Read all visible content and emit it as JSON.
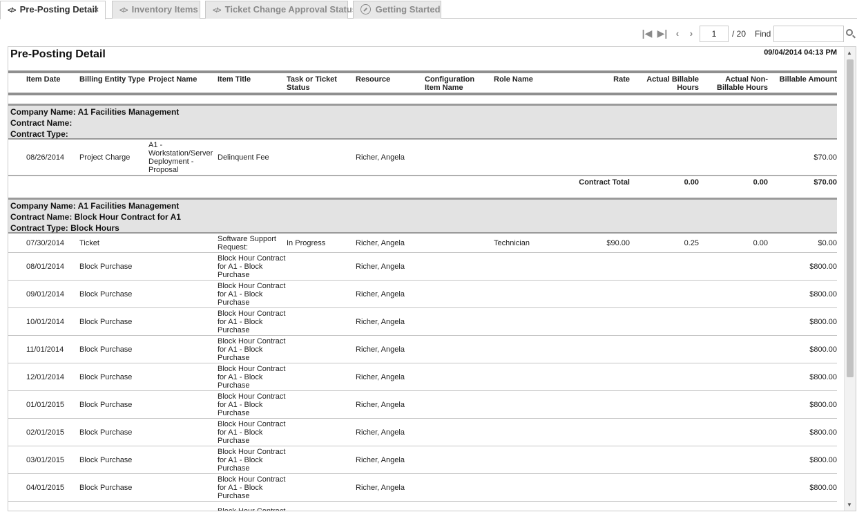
{
  "tabs": [
    {
      "label": "Pre-Posting Detail",
      "icon": "code-icon",
      "close": "×"
    },
    {
      "label": "Inventory Items",
      "icon": "code-icon"
    },
    {
      "label": "Ticket Change Approval Status",
      "icon": "code-icon"
    },
    {
      "label": "Getting Started",
      "icon": "arrow-circle-icon"
    }
  ],
  "toolbar": {
    "page": "1",
    "page_total": "/ 20",
    "find_label": "Find",
    "find_value": ""
  },
  "report": {
    "title": "Pre-Posting Detail",
    "date": "09/04/2014 04:13 PM",
    "columns": [
      "Item Date",
      "Billing Entity Type",
      "Project Name",
      "Item Title",
      "Task or Ticket Status",
      "Resource",
      "Configuration Item Name",
      "Role Name",
      "Rate",
      "Actual Billable Hours",
      "Actual Non-Billable Hours",
      "Billable Amount"
    ],
    "groups": [
      {
        "company": "Company Name: A1 Facilities Management",
        "contract": "Contract Name:",
        "contract_type": "Contract Type:",
        "rows": [
          {
            "date": "08/26/2014",
            "type": "Project Charge",
            "project": "A1 - Workstation/Server Deployment - Proposal",
            "title": "Delinquent Fee",
            "status": "",
            "resource": "Richer, Angela",
            "ci": "",
            "role": "",
            "rate": "",
            "billable": "",
            "nonbillable": "",
            "amount": "$70.00"
          }
        ],
        "total": {
          "label": "Contract Total",
          "billable": "0.00",
          "nonbillable": "0.00",
          "amount": "$70.00"
        }
      },
      {
        "company": "Company Name: A1 Facilities Management",
        "contract": "Contract Name: Block Hour Contract for A1",
        "contract_type": "Contract Type: Block Hours",
        "rows": [
          {
            "date": "07/30/2014",
            "type": "Ticket",
            "project": "",
            "title": "Software Support Request:",
            "status": "In Progress",
            "resource": "Richer, Angela",
            "ci": "",
            "role": "Technician",
            "rate": "$90.00",
            "billable": "0.25",
            "nonbillable": "0.00",
            "amount": "$0.00"
          },
          {
            "date": "08/01/2014",
            "type": "Block Purchase",
            "project": "",
            "title": "Block Hour Contract for A1 - Block Purchase",
            "status": "",
            "resource": "Richer, Angela",
            "ci": "",
            "role": "",
            "rate": "",
            "billable": "",
            "nonbillable": "",
            "amount": "$800.00"
          },
          {
            "date": "09/01/2014",
            "type": "Block Purchase",
            "project": "",
            "title": "Block Hour Contract for A1 - Block Purchase",
            "status": "",
            "resource": "Richer, Angela",
            "ci": "",
            "role": "",
            "rate": "",
            "billable": "",
            "nonbillable": "",
            "amount": "$800.00"
          },
          {
            "date": "10/01/2014",
            "type": "Block Purchase",
            "project": "",
            "title": "Block Hour Contract for A1 - Block Purchase",
            "status": "",
            "resource": "Richer, Angela",
            "ci": "",
            "role": "",
            "rate": "",
            "billable": "",
            "nonbillable": "",
            "amount": "$800.00"
          },
          {
            "date": "11/01/2014",
            "type": "Block Purchase",
            "project": "",
            "title": "Block Hour Contract for A1 - Block Purchase",
            "status": "",
            "resource": "Richer, Angela",
            "ci": "",
            "role": "",
            "rate": "",
            "billable": "",
            "nonbillable": "",
            "amount": "$800.00"
          },
          {
            "date": "12/01/2014",
            "type": "Block Purchase",
            "project": "",
            "title": "Block Hour Contract for A1 - Block Purchase",
            "status": "",
            "resource": "Richer, Angela",
            "ci": "",
            "role": "",
            "rate": "",
            "billable": "",
            "nonbillable": "",
            "amount": "$800.00"
          },
          {
            "date": "01/01/2015",
            "type": "Block Purchase",
            "project": "",
            "title": "Block Hour Contract for A1 - Block Purchase",
            "status": "",
            "resource": "Richer, Angela",
            "ci": "",
            "role": "",
            "rate": "",
            "billable": "",
            "nonbillable": "",
            "amount": "$800.00"
          },
          {
            "date": "02/01/2015",
            "type": "Block Purchase",
            "project": "",
            "title": "Block Hour Contract for A1 - Block Purchase",
            "status": "",
            "resource": "Richer, Angela",
            "ci": "",
            "role": "",
            "rate": "",
            "billable": "",
            "nonbillable": "",
            "amount": "$800.00"
          },
          {
            "date": "03/01/2015",
            "type": "Block Purchase",
            "project": "",
            "title": "Block Hour Contract for A1 - Block Purchase",
            "status": "",
            "resource": "Richer, Angela",
            "ci": "",
            "role": "",
            "rate": "",
            "billable": "",
            "nonbillable": "",
            "amount": "$800.00"
          },
          {
            "date": "04/01/2015",
            "type": "Block Purchase",
            "project": "",
            "title": "Block Hour Contract for A1 - Block Purchase",
            "status": "",
            "resource": "Richer, Angela",
            "ci": "",
            "role": "",
            "rate": "",
            "billable": "",
            "nonbillable": "",
            "amount": "$800.00"
          },
          {
            "date": "",
            "type": "",
            "project": "",
            "title": "Block Hour Contract",
            "status": "",
            "resource": "",
            "ci": "",
            "role": "",
            "rate": "",
            "billable": "",
            "nonbillable": "",
            "amount": ""
          }
        ]
      }
    ]
  }
}
